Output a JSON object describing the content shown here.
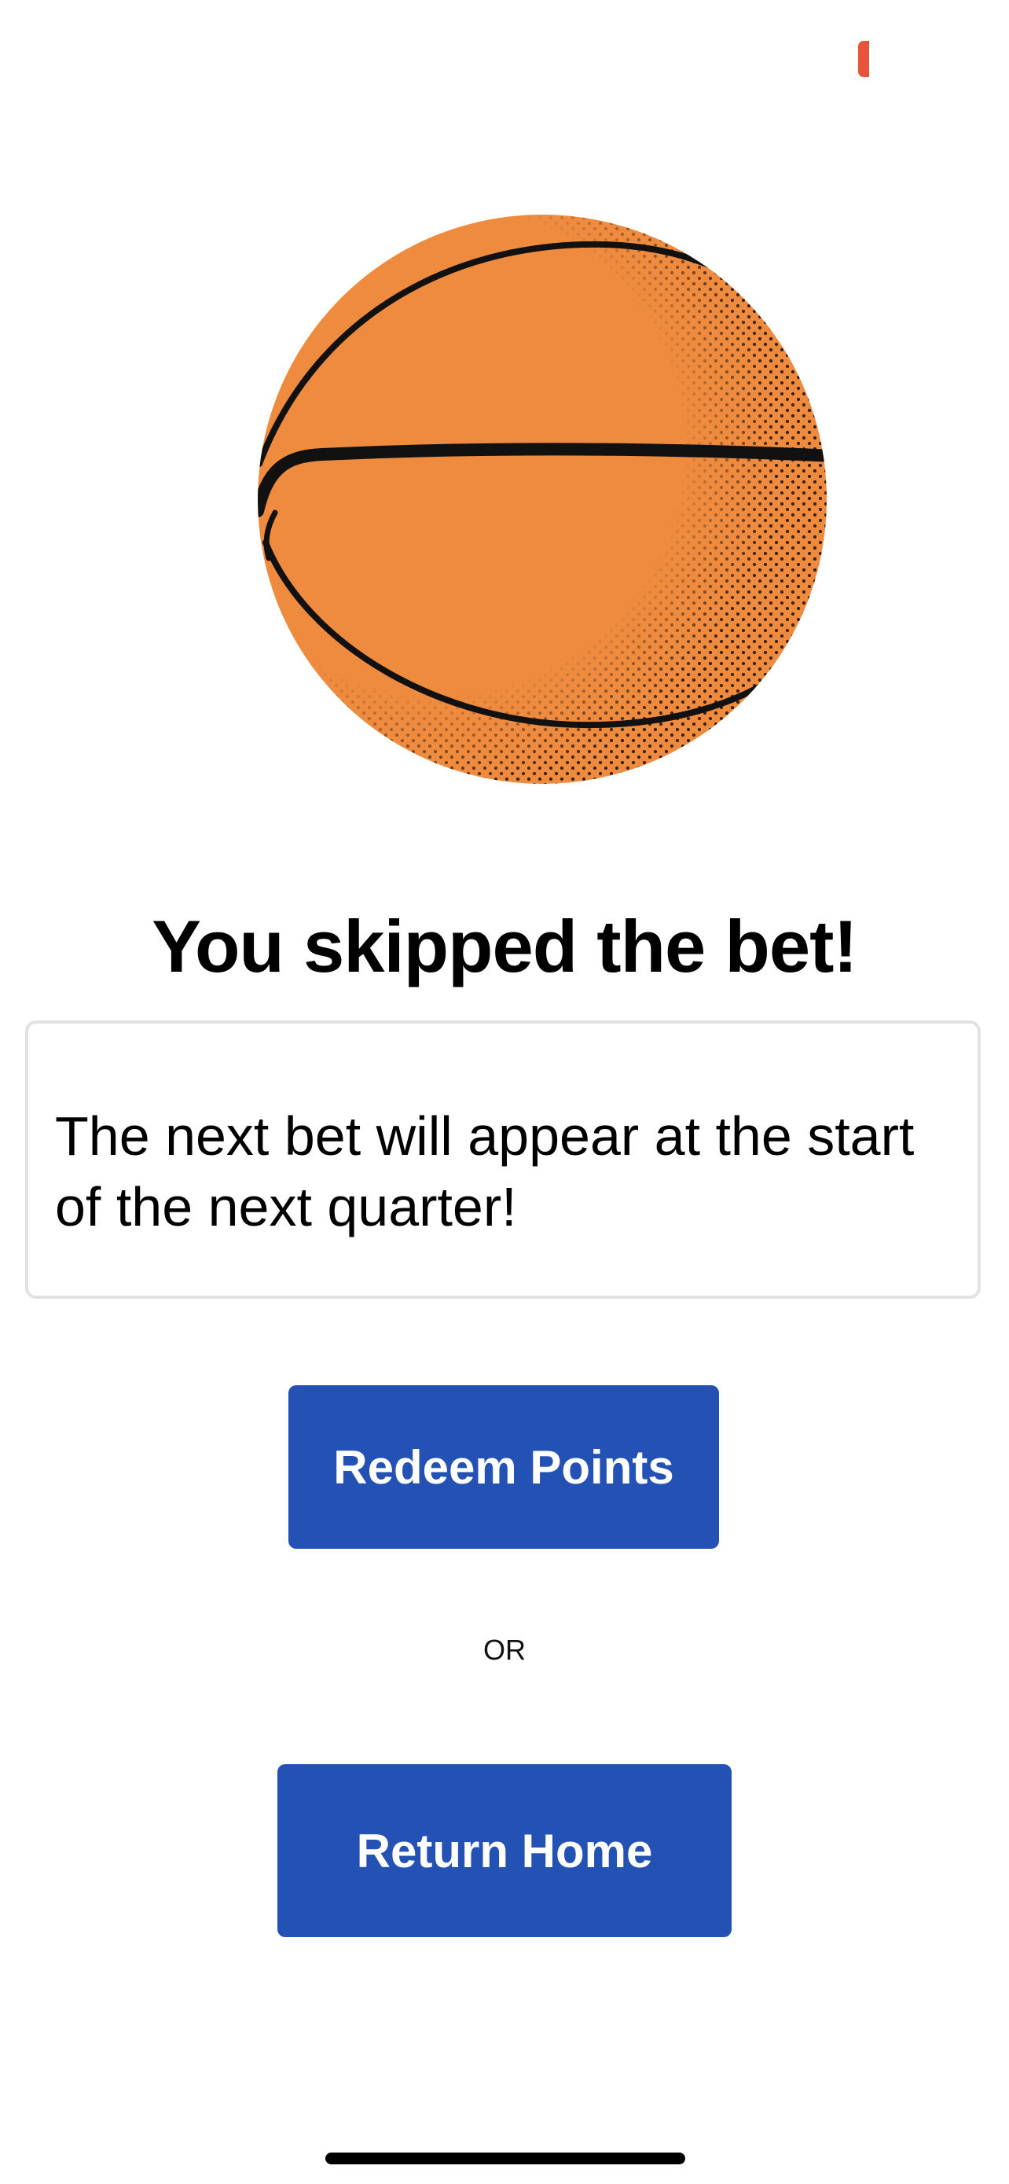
{
  "status": {
    "indicator_color": "#e8533c"
  },
  "hero": {
    "icon": "basketball-icon",
    "ball_color": "#ef8b3f"
  },
  "title": "You skipped the bet!",
  "message": "The next bet will appear at the start of the next quarter!",
  "actions": {
    "redeem_label": "Redeem Points",
    "separator": "OR",
    "home_label": "Return Home"
  },
  "colors": {
    "button_bg": "#2451b4",
    "button_text": "#ffffff",
    "box_border": "#e2e2e2"
  }
}
